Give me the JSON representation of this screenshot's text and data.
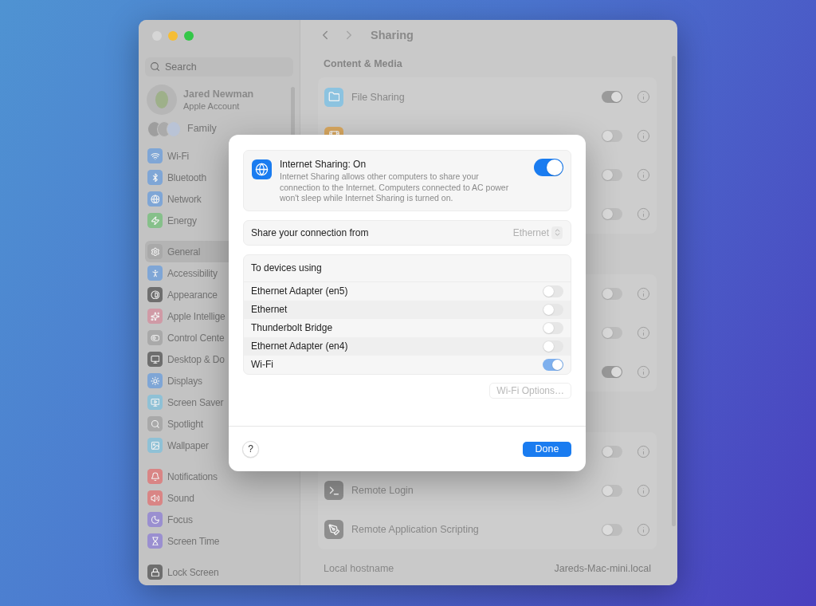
{
  "sidebar": {
    "search": {
      "placeholder": "Search"
    },
    "account": {
      "name": "Jared Newman",
      "subtitle": "Apple Account"
    },
    "family": {
      "label": "Family"
    },
    "groups": [
      {
        "items": [
          {
            "label": "Wi-Fi",
            "kind": "wifi",
            "color": "#7fa6d6",
            "selected": false
          },
          {
            "label": "Bluetooth",
            "kind": "bluetooth",
            "color": "#7fa6d6",
            "selected": false
          },
          {
            "label": "Network",
            "kind": "globe",
            "color": "#7fa6d6",
            "selected": false
          },
          {
            "label": "Energy",
            "kind": "energy",
            "color": "#86c08a",
            "selected": false
          }
        ]
      },
      {
        "items": [
          {
            "label": "General",
            "kind": "gear",
            "color": "#a9a9a9",
            "selected": true
          },
          {
            "label": "Accessibility",
            "kind": "accessibility",
            "color": "#7fa6d6",
            "selected": false
          },
          {
            "label": "Appearance",
            "kind": "contrast",
            "color": "#6e6e6e",
            "selected": false
          },
          {
            "label": "Apple Intellige",
            "kind": "sparkle",
            "color": "#d09aa6",
            "selected": false
          },
          {
            "label": "Control Cente",
            "kind": "toggle",
            "color": "#a9a9a9",
            "selected": false
          },
          {
            "label": "Desktop & Do",
            "kind": "monitor",
            "color": "#6e6e6e",
            "selected": false
          },
          {
            "label": "Displays",
            "kind": "sun",
            "color": "#7fa6d6",
            "selected": false
          },
          {
            "label": "Screen Saver",
            "kind": "screen",
            "color": "#8fc1d6",
            "selected": false
          },
          {
            "label": "Spotlight",
            "kind": "search",
            "color": "#a9a9a9",
            "selected": false
          },
          {
            "label": "Wallpaper",
            "kind": "image",
            "color": "#8fc1d6",
            "selected": false
          }
        ]
      },
      {
        "items": [
          {
            "label": "Notifications",
            "kind": "bell",
            "color": "#d98585",
            "selected": false
          },
          {
            "label": "Sound",
            "kind": "speaker",
            "color": "#d98585",
            "selected": false
          },
          {
            "label": "Focus",
            "kind": "moon",
            "color": "#9a8fd0",
            "selected": false
          },
          {
            "label": "Screen Time",
            "kind": "hourglass",
            "color": "#9a8fd0",
            "selected": false
          }
        ]
      },
      {
        "items": [
          {
            "label": "Lock Screen",
            "kind": "lock",
            "color": "#6e6e6e",
            "selected": false
          }
        ]
      }
    ]
  },
  "main": {
    "title": "Sharing",
    "sections": [
      {
        "title": "Content & Media",
        "rows": [
          {
            "label": "File Sharing",
            "kind": "folder",
            "color": "#8cc3e0",
            "on": true
          },
          {
            "kind": "film",
            "color": "#d9a860",
            "on": false
          },
          {
            "on": false
          },
          {
            "on": false
          }
        ]
      },
      {
        "rows": [
          {
            "on": false
          },
          {
            "on": false
          },
          {
            "on": true
          }
        ]
      },
      {
        "rows": [
          {
            "on": false
          },
          {
            "label": "Remote Login",
            "kind": "terminal",
            "color": "#8e8e8e",
            "on": false
          },
          {
            "label": "Remote Application Scripting",
            "kind": "pen",
            "color": "#8e8e8e",
            "on": false
          }
        ]
      }
    ],
    "hostname": {
      "label": "Local hostname",
      "value": "Jareds-Mac-mini.local"
    }
  },
  "dialog": {
    "service": {
      "title": "Internet Sharing: On",
      "description": "Internet Sharing allows other computers to share your connection to the Internet. Computers connected to AC power won't sleep while Internet Sharing is turned on.",
      "on": true
    },
    "source": {
      "label": "Share your connection from",
      "value": "Ethernet"
    },
    "devices": {
      "title": "To devices using",
      "items": [
        {
          "label": "Ethernet Adapter (en5)",
          "on": false
        },
        {
          "label": "Ethernet",
          "on": false
        },
        {
          "label": "Thunderbolt Bridge",
          "on": false
        },
        {
          "label": "Ethernet Adapter (en4)",
          "on": false
        },
        {
          "label": "Wi-Fi",
          "on": true
        }
      ]
    },
    "options_button": {
      "label": "Wi-Fi Options…",
      "disabled": true
    },
    "help_button": {
      "label": "?"
    },
    "done_button": {
      "label": "Done"
    }
  }
}
